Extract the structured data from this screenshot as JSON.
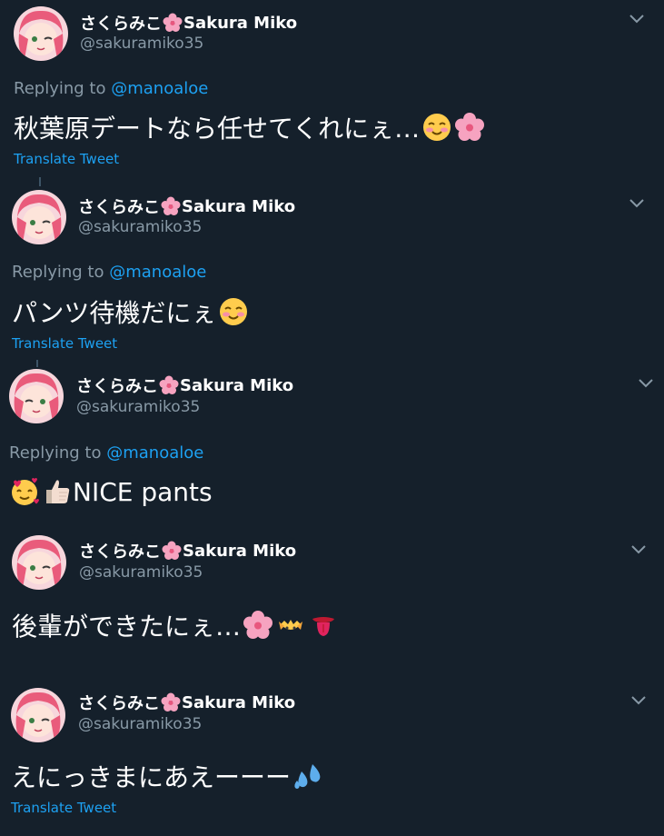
{
  "tweets": [
    {
      "display_name": "さくらみこ",
      "display_name_suffix": "Sakura Miko",
      "handle": "@sakuramiko35",
      "replying_prefix": "Replying to",
      "replying_to": "@manoaloe",
      "text": "秋葉原デートなら任せてくれにぇ…",
      "emojis": [
        "smiling-blush-emoji",
        "cherry-blossom-emoji"
      ],
      "translate_label": "Translate Tweet"
    },
    {
      "display_name": "さくらみこ",
      "display_name_suffix": "Sakura Miko",
      "handle": "@sakuramiko35",
      "replying_prefix": "Replying to",
      "replying_to": "@manoaloe",
      "text": "パンツ待機だにぇ",
      "emojis": [
        "smiling-blush-emoji"
      ],
      "translate_label": "Translate Tweet"
    },
    {
      "display_name": "さくらみこ",
      "display_name_suffix": "Sakura Miko",
      "handle": "@sakuramiko35",
      "replying_prefix": "Replying to",
      "replying_to": "@manoaloe",
      "text": "NICE pants",
      "emojis_before": [
        "smiling-hearts-emoji",
        "thumbs-up-emoji"
      ]
    },
    {
      "display_name": "さくらみこ",
      "display_name_suffix": "Sakura Miko",
      "handle": "@sakuramiko35",
      "text": "後輩ができたにぇ…",
      "emojis": [
        "cherry-blossom-emoji",
        "hatching-chick-emoji",
        "tongue-emoji"
      ]
    },
    {
      "display_name": "さくらみこ",
      "display_name_suffix": "Sakura Miko",
      "handle": "@sakuramiko35",
      "text": "えにっきまにあえーーー",
      "emojis": [
        "sweat-droplets-emoji"
      ],
      "translate_label": "Translate Tweet"
    }
  ],
  "colors": {
    "background": "#15202b",
    "text": "#ffffff",
    "secondary": "#8899a6",
    "link": "#1da1f2"
  }
}
